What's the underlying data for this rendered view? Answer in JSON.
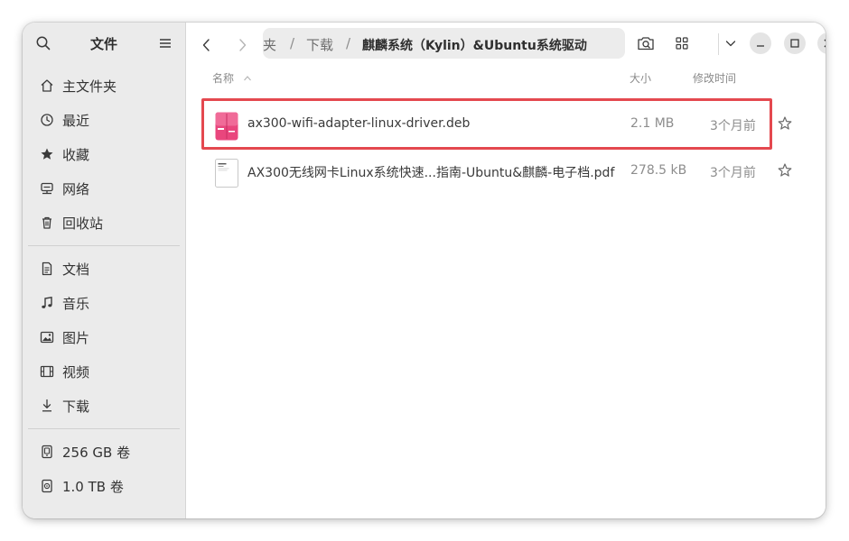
{
  "sidebar": {
    "title": "文件",
    "places": [
      {
        "label": "主文件夹",
        "icon": "home-icon"
      },
      {
        "label": "最近",
        "icon": "clock-icon"
      },
      {
        "label": "收藏",
        "icon": "star-icon"
      },
      {
        "label": "网络",
        "icon": "network-icon"
      },
      {
        "label": "回收站",
        "icon": "trash-icon"
      }
    ],
    "folders": [
      {
        "label": "文档",
        "icon": "document-icon"
      },
      {
        "label": "音乐",
        "icon": "music-icon"
      },
      {
        "label": "图片",
        "icon": "picture-icon"
      },
      {
        "label": "视频",
        "icon": "video-icon"
      },
      {
        "label": "下载",
        "icon": "download-icon"
      }
    ],
    "volumes": [
      {
        "label": "256 GB 卷",
        "icon": "drive-icon"
      },
      {
        "label": "1.0 TB 卷",
        "icon": "drive-icon"
      }
    ]
  },
  "pathbar": {
    "crumbs": [
      "夹",
      "下载",
      "麒麟系统（Kylin）&Ubuntu系统驱动"
    ],
    "separator": "/"
  },
  "columns": {
    "name": "名称",
    "size": "大小",
    "modified": "修改时间"
  },
  "files": [
    {
      "name": "ax300-wifi-adapter-linux-driver.deb",
      "size": "2.1 MB",
      "modified": "3个月前",
      "icon": "deb-package-icon",
      "highlighted": true
    },
    {
      "name": "AX300无线网卡Linux系统快速...指南-Ubuntu&麒麟-电子档.pdf",
      "size": "278.5 kB",
      "modified": "3个月前",
      "icon": "pdf-document-icon",
      "highlighted": false
    }
  ],
  "colors": {
    "highlight_border": "#e4484f",
    "sidebar_bg": "#ebebeb",
    "pathbar_bg": "#ececec",
    "deb_icon": "#e9467d"
  }
}
